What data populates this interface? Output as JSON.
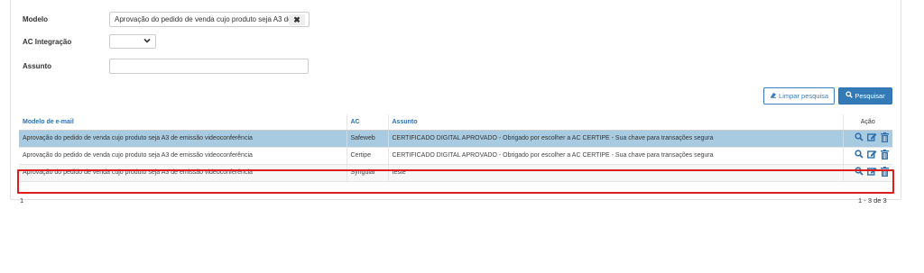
{
  "filters": {
    "modelo": {
      "label": "Modelo",
      "value": "Aprovação do pedido de venda cujo produto seja A3 de",
      "clear_glyph": "✖"
    },
    "ac_integracao": {
      "label": "AC Integração",
      "value": ""
    },
    "assunto": {
      "label": "Assunto",
      "value": ""
    }
  },
  "actions": {
    "clear_label": "Limpar pesquisa",
    "search_label": "Pesquisar"
  },
  "table": {
    "headers": {
      "model": "Modelo de e-mail",
      "ac": "AC",
      "subject": "Assunto",
      "action": "Ação"
    },
    "rows": [
      {
        "model": "Aprovação do pedido de venda cujo produto seja A3 de emissão videoconferência",
        "ac": "Safeweb",
        "subject": "CERTIFICADO DIGITAL APROVADO - Obrigado por escolher a AC CERTIPE - Sua chave para transações segura"
      },
      {
        "model": "Aprovação do pedido de venda cujo produto seja A3 de emissão videoconferência",
        "ac": "Certipe",
        "subject": "CERTIFICADO DIGITAL APROVADO - Obrigado por escolher a AC CERTIPE - Sua chave para transações segura"
      },
      {
        "model": "Aprovação do pedido de venda cujo produto seja A3 de emissão videoconferência",
        "ac": "Syngular",
        "subject": "teste"
      }
    ]
  },
  "pager": {
    "page": "1",
    "range": "1 - 3 de 3"
  },
  "colors": {
    "primary": "#337ab7",
    "selected_row": "#a9cbe1",
    "highlight_box": "#e01d1d"
  }
}
